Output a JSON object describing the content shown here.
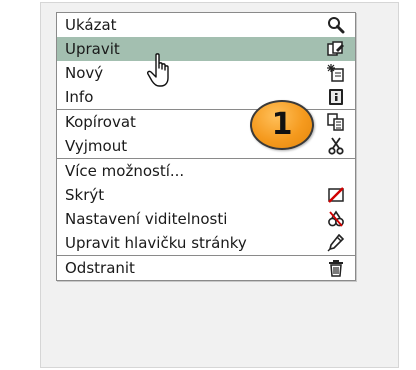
{
  "menu": {
    "groups": [
      {
        "items": [
          {
            "label": "Ukázat",
            "icon": "magnifier-icon"
          },
          {
            "label": "Upravit",
            "icon": "edit-page-icon",
            "state": "hover"
          },
          {
            "label": "Nový",
            "icon": "new-page-icon"
          },
          {
            "label": "Info",
            "icon": "info-icon"
          }
        ]
      },
      {
        "items": [
          {
            "label": "Kopírovat",
            "icon": "copy-icon"
          },
          {
            "label": "Vyjmout",
            "icon": "scissors-icon"
          }
        ]
      },
      {
        "items": [
          {
            "label": "Více možností...",
            "icon": ""
          },
          {
            "label": "Skrýt",
            "icon": "hide-icon"
          },
          {
            "label": "Nastavení viditelnosti",
            "icon": "visibility-settings-icon"
          },
          {
            "label": "Upravit hlavičku stránky",
            "icon": "pen-icon"
          }
        ]
      },
      {
        "items": [
          {
            "label": "Odstranit",
            "icon": "trash-icon"
          }
        ]
      }
    ]
  },
  "badge": {
    "number": "1",
    "color": "#f59a1e"
  },
  "colors": {
    "hover": "#a3bfb0",
    "panel": "#f1f1f1",
    "border": "#8a8a8a"
  }
}
